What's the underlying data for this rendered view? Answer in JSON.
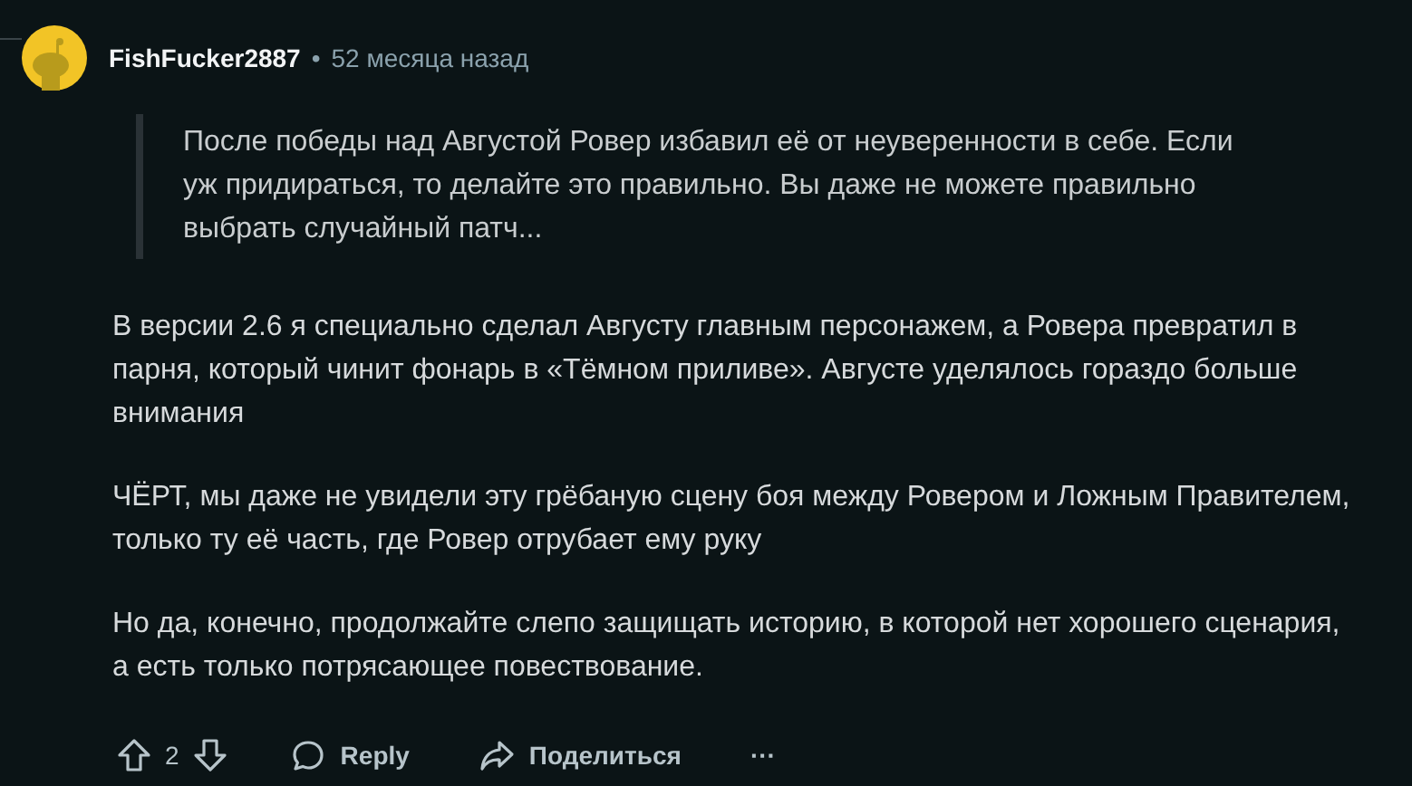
{
  "comment": {
    "author": "FishFucker2887",
    "separator": "•",
    "time": "52 месяца назад",
    "quote": "После победы над Августой Ровер избавил её от неуверенности в себе. Если уж придираться, то делайте это правильно. Вы даже не можете правильно выбрать случайный патч...",
    "paragraphs": [
      "В версии 2.6 я специально сделал Августу главным персонажем, а Ровера превратил в парня, который чинит фонарь в «Тёмном приливе». Августе уделялось гораздо больше внимания",
      "ЧЁРТ, мы даже не увидели эту грёбаную сцену боя между Ровером и Ложным Правителем, только ту её часть, где Ровер отрубает ему руку",
      "Но да, конечно, продолжайте слепо защищать историю, в которой нет хорошего сценария, а есть только потрясающее повествование."
    ]
  },
  "actions": {
    "score": "2",
    "reply": "Reply",
    "share": "Поделиться",
    "more": "···"
  }
}
